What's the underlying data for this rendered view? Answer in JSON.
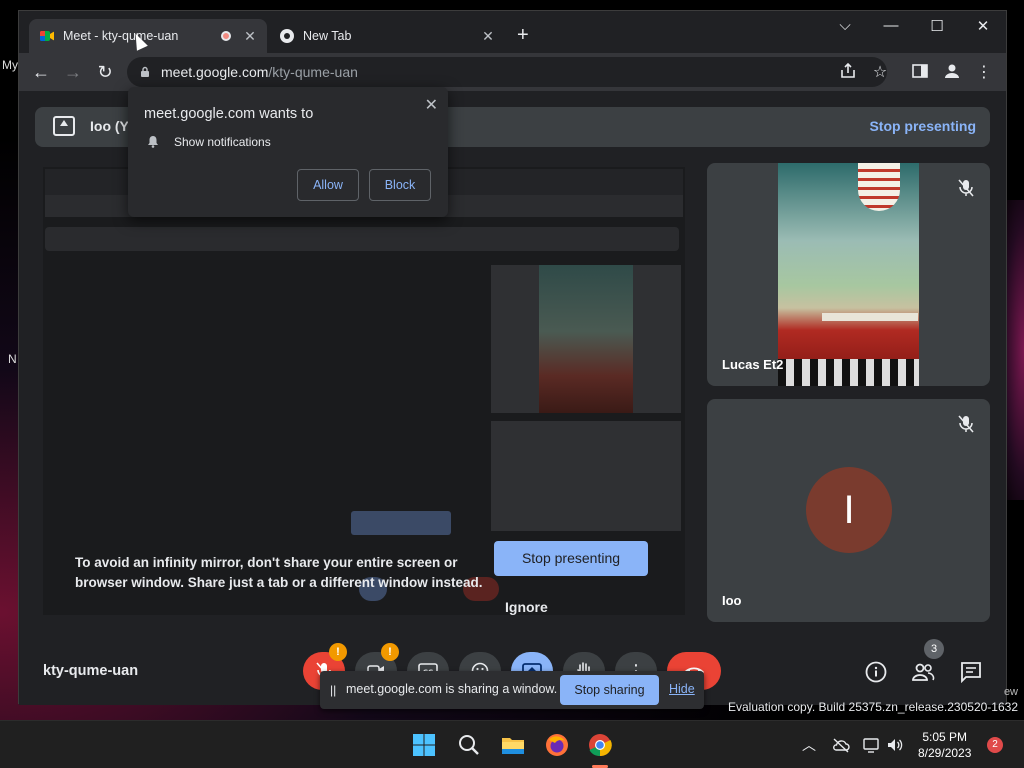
{
  "desktop": {
    "left_text_1": "My",
    "left_text_2": "N"
  },
  "browser": {
    "tabs": [
      {
        "title": "Meet - kty-qume-uan",
        "icon": "google-meet-icon",
        "recording": true
      },
      {
        "title": "New Tab",
        "icon": "chrome-icon"
      }
    ],
    "new_tab_symbol": "+",
    "window_controls": {
      "dropdown": "⌵",
      "minimize": "—",
      "maximize": "☐",
      "close": "✕"
    },
    "url_host": "meet.google.com",
    "url_path": "/kty-qume-uan"
  },
  "permission_popup": {
    "title": "meet.google.com wants to",
    "item": "Show notifications",
    "allow": "Allow",
    "block": "Block"
  },
  "meet": {
    "banner_label": "Ioo (You, presenting)",
    "banner_stop": "Stop presenting",
    "infinity_text": "To avoid an infinity mirror, don't share your entire screen or browser window. Share just a tab or a different window instead.",
    "stop_presenting_btn": "Stop presenting",
    "ignore": "Ignore",
    "participants": [
      {
        "name": "Lucas Et2",
        "muted": true
      },
      {
        "name": "Ioo",
        "initial": "I",
        "muted": true
      }
    ],
    "meeting_code": "kty-qume-uan",
    "people_count": "3",
    "alert_badge": "!"
  },
  "share_bar": {
    "pause": "||",
    "message": "meet.google.com is sharing a window.",
    "stop": "Stop sharing",
    "hide": "Hide"
  },
  "watermark": {
    "line": "Evaluation copy. Build 25375.zn_release.230520-1632",
    "new_partial": "ew"
  },
  "taskbar": {
    "time": "5:05 PM",
    "date": "8/29/2023",
    "notification_count": "2"
  },
  "colors": {
    "accent_blue": "#8ab4f8",
    "end_red": "#ea4335",
    "bg": "#202124"
  }
}
